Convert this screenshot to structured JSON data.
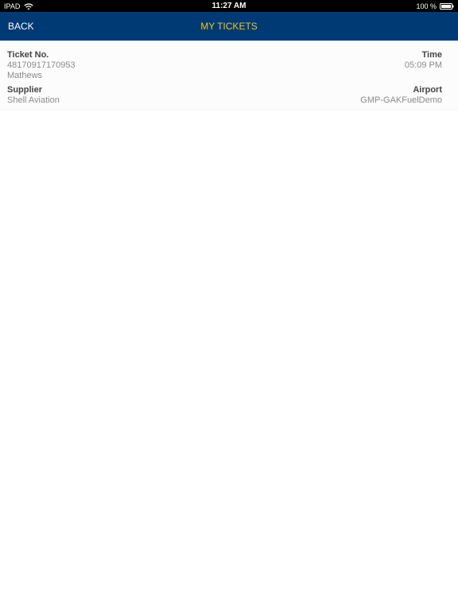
{
  "status_bar": {
    "device": "IPAD",
    "time": "11:27 AM",
    "battery": "100 %"
  },
  "nav": {
    "back_label": "BACK",
    "title": "MY TICKETS"
  },
  "ticket": {
    "ticket_no_label": "Ticket No.",
    "ticket_no": "48170917170953",
    "customer": "Mathews",
    "time_label": "Time",
    "time": "05:09 PM",
    "supplier_label": "Supplier",
    "supplier": "Shell Aviation",
    "airport_label": "Airport",
    "airport": "GMP-GAKFuelDemo"
  },
  "colors": {
    "nav_background": "#003a75",
    "title_color": "#f2c618",
    "label_color": "#444444",
    "value_color": "#8a8a8a"
  },
  "icons": [
    "wifi-icon",
    "battery-icon"
  ]
}
